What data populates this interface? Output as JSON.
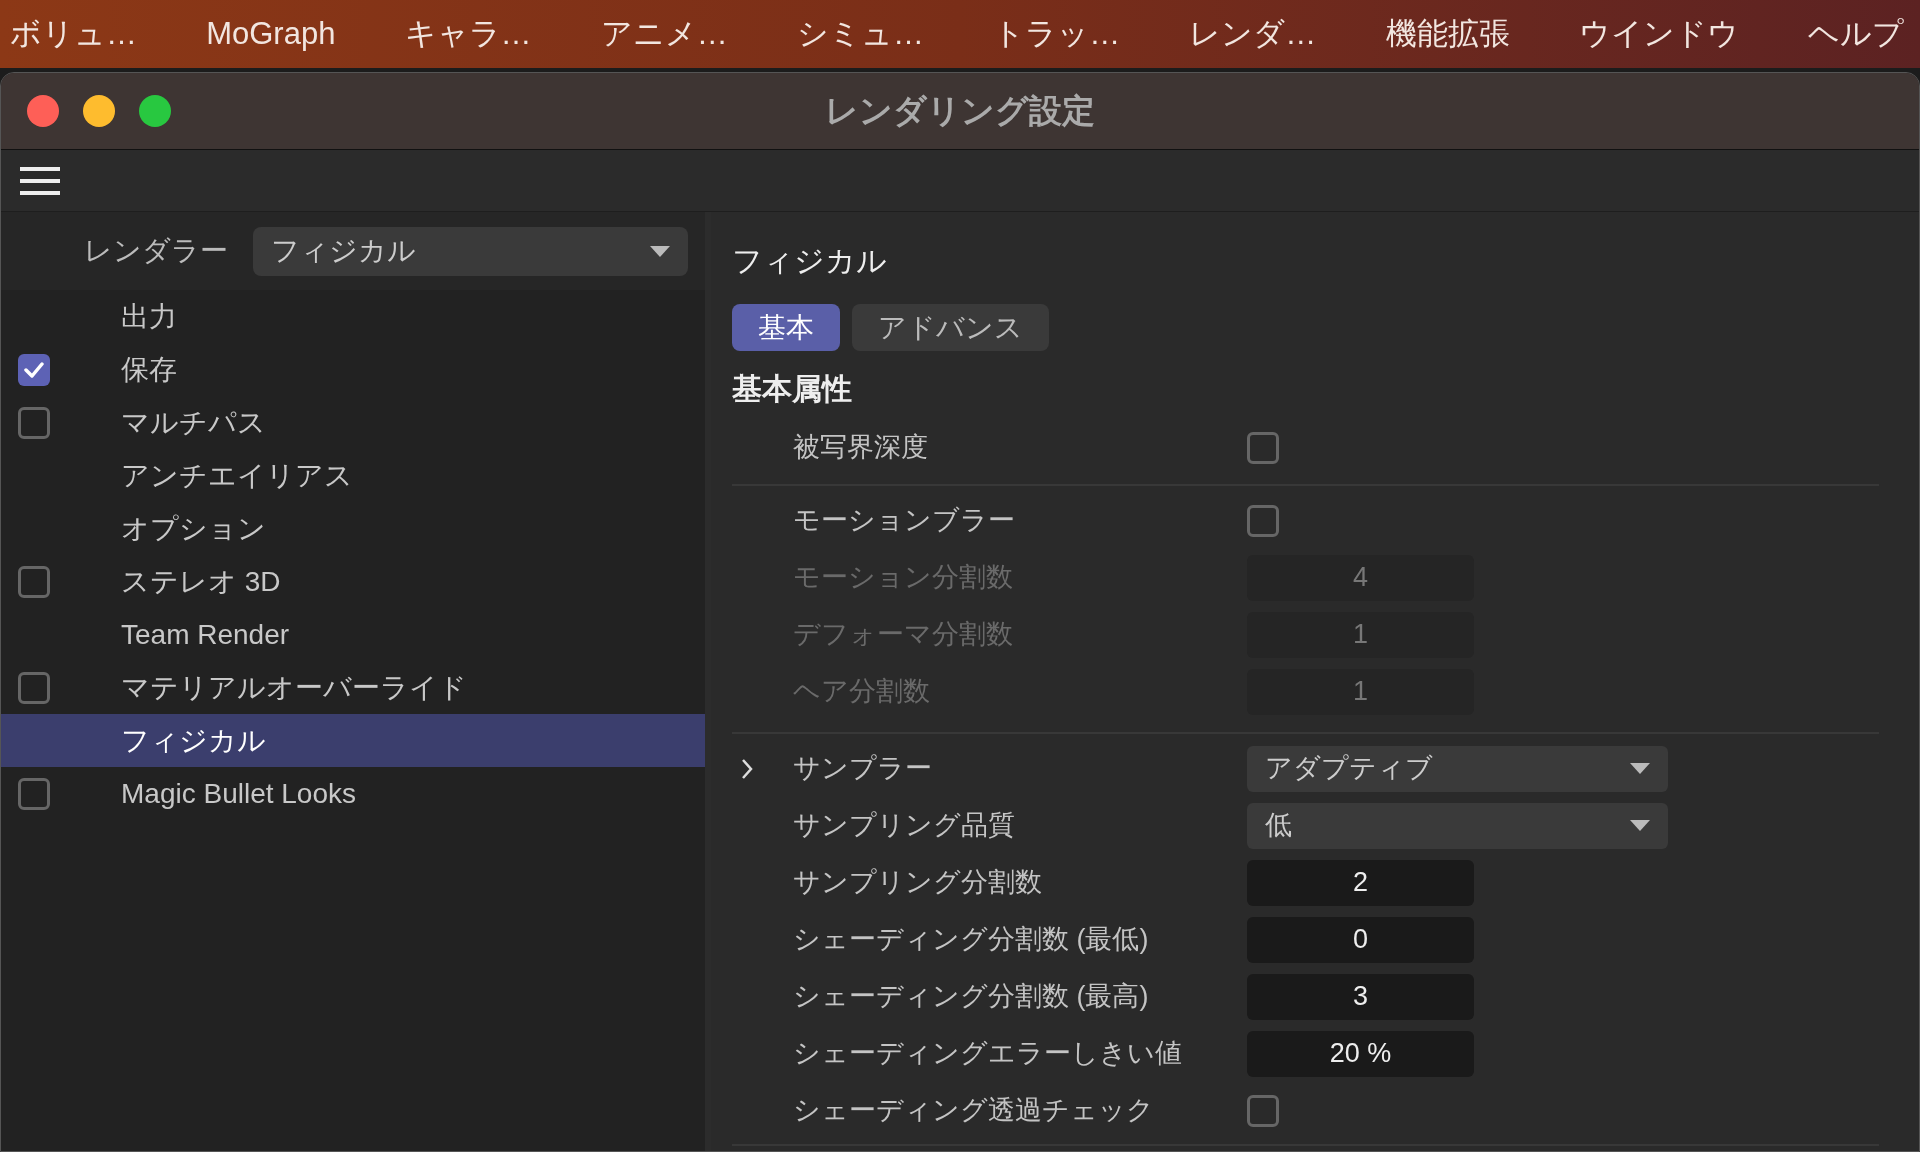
{
  "menu_bar": [
    "ボリュ…",
    "MoGraph",
    "キャラ…",
    "アニメ…",
    "シミュ…",
    "トラッ…",
    "レンダ…",
    "機能拡張",
    "ウインドウ",
    "ヘルプ"
  ],
  "window": {
    "title": "レンダリング設定"
  },
  "renderer": {
    "label": "レンダラー",
    "value": "フィジカル"
  },
  "sidebar": {
    "items": [
      {
        "label": "出力",
        "kind": "page",
        "selected": false
      },
      {
        "label": "保存",
        "kind": "toggle",
        "checked": true,
        "selected": false
      },
      {
        "label": "マルチパス",
        "kind": "toggle",
        "checked": false,
        "selected": false
      },
      {
        "label": "アンチエイリアス",
        "kind": "page",
        "selected": false
      },
      {
        "label": "オプション",
        "kind": "page",
        "selected": false
      },
      {
        "label": "ステレオ 3D",
        "kind": "toggle",
        "checked": false,
        "selected": false
      },
      {
        "label": "Team Render",
        "kind": "page",
        "selected": false
      },
      {
        "label": "マテリアルオーバーライド",
        "kind": "toggle",
        "checked": false,
        "selected": false
      },
      {
        "label": "フィジカル",
        "kind": "page",
        "selected": true
      },
      {
        "label": "Magic Bullet Looks",
        "kind": "toggle",
        "checked": false,
        "selected": false
      }
    ]
  },
  "panel": {
    "title": "フィジカル",
    "tabs": [
      {
        "label": "基本",
        "selected": true
      },
      {
        "label": "アドバンス",
        "selected": false
      }
    ],
    "group_title": "基本属性",
    "sections": [
      {
        "rows": [
          {
            "label": "被写界深度",
            "kind": "checkbox",
            "checked": false,
            "disabled": false
          }
        ]
      },
      {
        "rows": [
          {
            "label": "モーションブラー",
            "kind": "checkbox",
            "checked": false,
            "disabled": false
          },
          {
            "label": "モーション分割数",
            "kind": "number",
            "value": "4",
            "disabled": true
          },
          {
            "label": "デフォーマ分割数",
            "kind": "number",
            "value": "1",
            "disabled": true
          },
          {
            "label": "ヘア分割数",
            "kind": "number",
            "value": "1",
            "disabled": true
          }
        ]
      },
      {
        "rows": [
          {
            "label": "サンプラー",
            "kind": "dropdown",
            "value": "アダプティブ",
            "disabled": false,
            "expanded": false
          },
          {
            "label": "サンプリング品質",
            "kind": "dropdown",
            "value": "低",
            "disabled": false
          },
          {
            "label": "サンプリング分割数",
            "kind": "number",
            "value": "2",
            "disabled": false
          },
          {
            "label": "シェーディング分割数 (最低)",
            "kind": "number",
            "value": "0",
            "disabled": false
          },
          {
            "label": "シェーディング分割数 (最高)",
            "kind": "number",
            "value": "3",
            "disabled": false
          },
          {
            "label": "シェーディングエラーしきい値",
            "kind": "number",
            "value": "20 %",
            "disabled": false
          },
          {
            "label": "シェーディング透過チェック",
            "kind": "checkbox",
            "checked": false,
            "disabled": false
          }
        ]
      }
    ]
  }
}
